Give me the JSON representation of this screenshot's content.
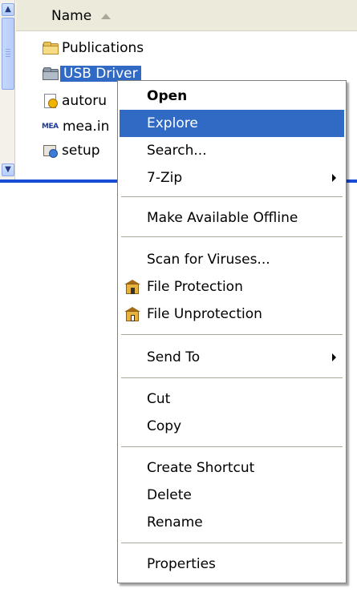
{
  "explorer": {
    "column_header": "Name",
    "files": [
      {
        "name": "Publications",
        "icon": "folder-icon"
      },
      {
        "name": "USB Driver",
        "icon": "gray-folder-icon",
        "selected": true
      },
      {
        "name": "autoru",
        "icon": "autorun-icon"
      },
      {
        "name": "mea.in",
        "icon": "mea-icon",
        "icon_text": "MEA"
      },
      {
        "name": "setup",
        "icon": "setup-icon"
      }
    ]
  },
  "context_menu": {
    "items": [
      {
        "label": "Open",
        "bold": true
      },
      {
        "label": "Explore",
        "highlighted": true
      },
      {
        "label": "Search..."
      },
      {
        "label": "7-Zip",
        "submenu": true
      },
      {
        "label": "Make Available Offline"
      },
      {
        "label": "Scan for Viruses..."
      },
      {
        "label": "File Protection",
        "icon": "lock-icon"
      },
      {
        "label": "File Unprotection",
        "icon": "unlock-icon"
      },
      {
        "label": "Send To",
        "submenu": true
      },
      {
        "label": "Cut"
      },
      {
        "label": "Copy"
      },
      {
        "label": "Create Shortcut"
      },
      {
        "label": "Delete"
      },
      {
        "label": "Rename"
      },
      {
        "label": "Properties"
      }
    ]
  },
  "colors": {
    "selection": "#316ac5",
    "header_bg": "#ebeadb",
    "accent_rule": "#1a4bd6"
  }
}
